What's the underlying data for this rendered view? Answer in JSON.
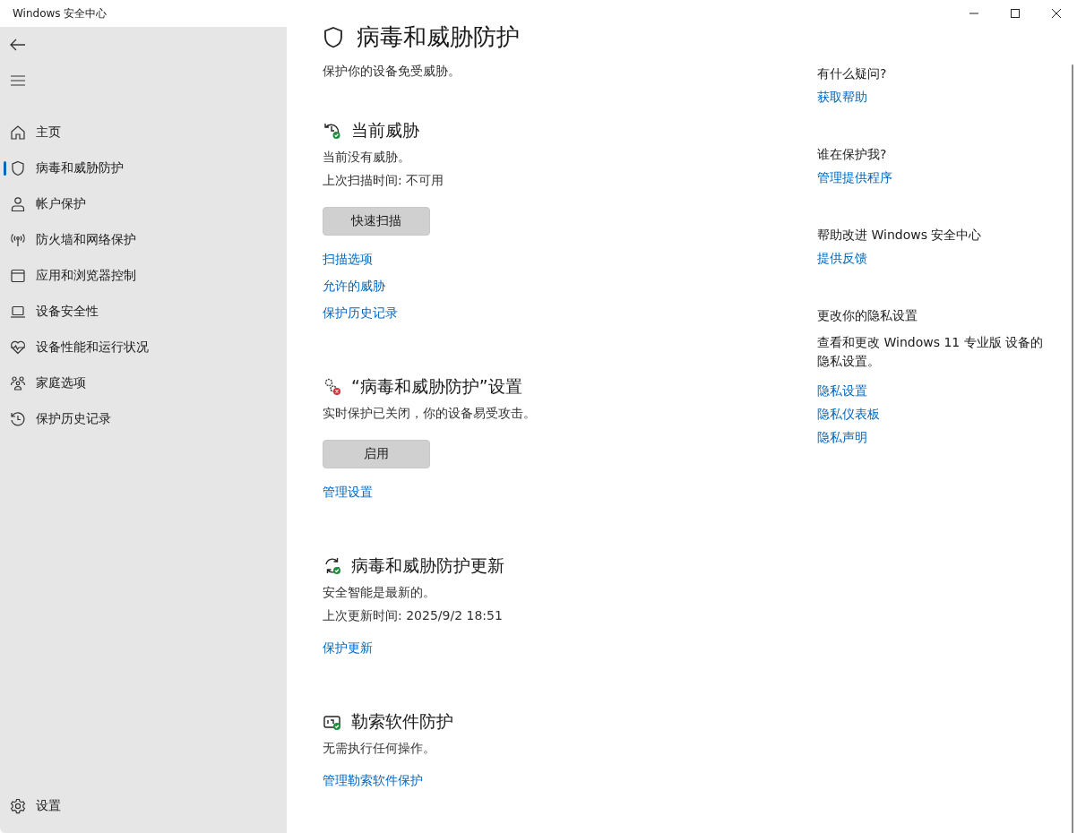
{
  "window": {
    "title": "Windows 安全中心"
  },
  "sidebar": {
    "items": [
      {
        "label": "主页",
        "selected": false
      },
      {
        "label": "病毒和威胁防护",
        "selected": true
      },
      {
        "label": "帐户保护",
        "selected": false
      },
      {
        "label": "防火墙和网络保护",
        "selected": false
      },
      {
        "label": "应用和浏览器控制",
        "selected": false
      },
      {
        "label": "设备安全性",
        "selected": false
      },
      {
        "label": "设备性能和运行状况",
        "selected": false
      },
      {
        "label": "家庭选项",
        "selected": false
      },
      {
        "label": "保护历史记录",
        "selected": false
      }
    ],
    "settings": {
      "label": "设置"
    }
  },
  "page": {
    "title": "病毒和威胁防护",
    "subtitle": "保护你的设备免受威胁。",
    "sections": [
      {
        "title": "当前威胁",
        "lines": [
          "当前没有威胁。",
          "上次扫描时间: 不可用"
        ],
        "button": "快速扫描",
        "links": [
          "扫描选项",
          "允许的威胁",
          "保护历史记录"
        ]
      },
      {
        "title": "“病毒和威胁防护”设置",
        "lines": [
          "实时保护已关闭，你的设备易受攻击。"
        ],
        "button": "启用",
        "links": [
          "管理设置"
        ]
      },
      {
        "title": "病毒和威胁防护更新",
        "lines": [
          "安全智能是最新的。",
          "上次更新时间: 2025/9/2 18:51"
        ],
        "links": [
          "保护更新"
        ]
      },
      {
        "title": "勒索软件防护",
        "lines": [
          "无需执行任何操作。"
        ],
        "links": [
          "管理勒索软件保护"
        ]
      }
    ]
  },
  "aside": [
    {
      "heading": "有什么疑问?",
      "links": [
        "获取帮助"
      ]
    },
    {
      "heading": "谁在保护我?",
      "links": [
        "管理提供程序"
      ]
    },
    {
      "heading": "帮助改进 Windows 安全中心",
      "links": [
        "提供反馈"
      ]
    },
    {
      "heading": "更改你的隐私设置",
      "text": "查看和更改 Windows 11 专业版 设备的隐私设置。",
      "links": [
        "隐私设置",
        "隐私仪表板",
        "隐私声明"
      ]
    }
  ]
}
